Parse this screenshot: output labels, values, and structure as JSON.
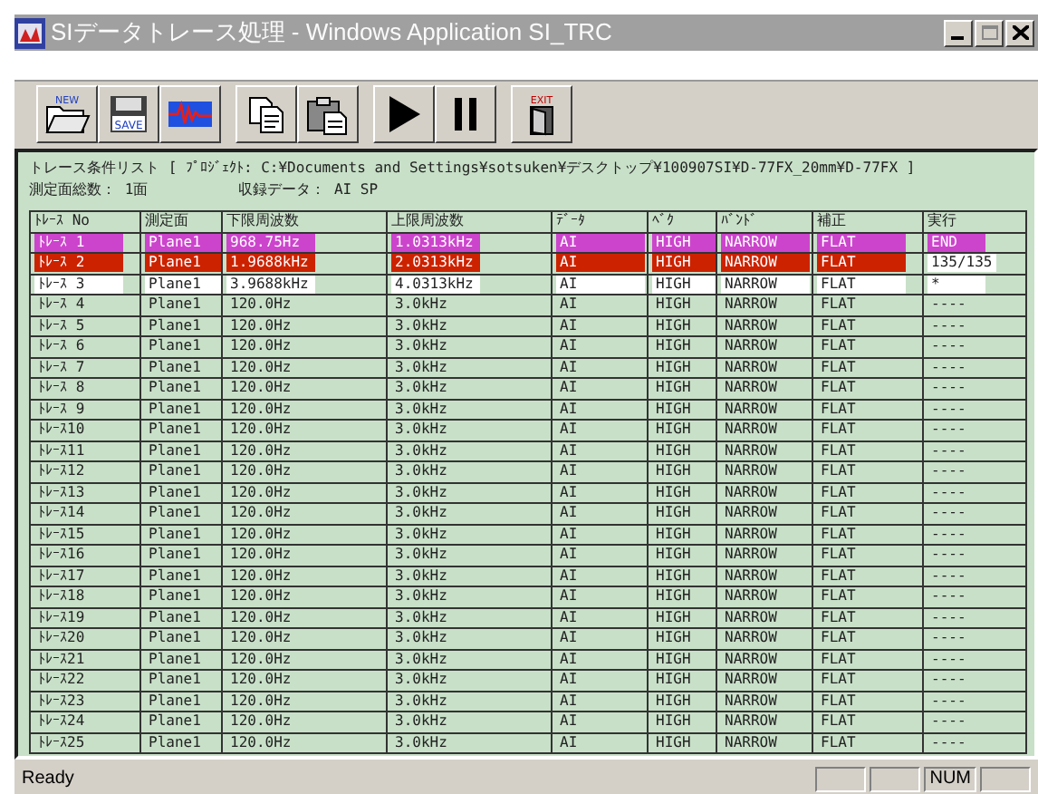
{
  "window": {
    "title": "SIデータトレース処理 - Windows  Application  SI_TRC"
  },
  "toolbar": [
    [
      {
        "kind": "new",
        "badge": "NEW"
      },
      {
        "kind": "save",
        "badge": "SAVE"
      },
      {
        "kind": "wave"
      }
    ],
    [
      {
        "kind": "copy"
      },
      {
        "kind": "paste"
      }
    ],
    [
      {
        "kind": "play"
      },
      {
        "kind": "pause"
      }
    ],
    [
      {
        "kind": "exit",
        "badge": "EXIT"
      }
    ]
  ],
  "info": {
    "list_title": "トレース条件リスト [ ﾌﾟﾛｼﾞｪｸﾄ: C:¥Documents and Settings¥sotsuken¥デスクトップ¥100907SI¥D-77FX_20mm¥D-77FX ]",
    "plane_count": "測定面総数： 1面",
    "recorded_data": "収録データ： AI  SP"
  },
  "table": {
    "columns": [
      "ﾄﾚｰｽ No",
      "測定面",
      "下限周波数",
      "上限周波数",
      "ﾃﾞｰﾀ",
      "ﾍﾞｸ",
      "ﾊﾞﾝﾄﾞ",
      "補正",
      "実行"
    ],
    "rows": [
      {
        "cells": [
          "ﾄﾚｰｽ 1",
          "Plane1",
          "968.75Hz",
          "1.0313kHz",
          "AI",
          "HIGH",
          "NARROW",
          "FLAT"
        ],
        "color": "#cc44cc",
        "exec": {
          "text": "END",
          "color": "#cc44cc"
        }
      },
      {
        "cells": [
          "ﾄﾚｰｽ 2",
          "Plane1",
          "1.9688kHz",
          "2.0313kHz",
          "AI",
          "HIGH",
          "NARROW",
          "FLAT"
        ],
        "color": "#cc2200",
        "exec": {
          "text": "135/135",
          "color": "#ffffff"
        }
      },
      {
        "cells": [
          "ﾄﾚｰｽ 3",
          "Plane1",
          "3.9688kHz",
          "4.0313kHz",
          "AI",
          "HIGH",
          "NARROW",
          "FLAT"
        ],
        "color": "#ffffff",
        "exec": {
          "text": "*",
          "color": "#ffffff"
        }
      },
      {
        "cells": [
          "ﾄﾚｰｽ 4",
          "Plane1",
          "120.0Hz",
          "3.0kHz",
          "AI",
          "HIGH",
          "NARROW",
          "FLAT",
          "----"
        ]
      },
      {
        "cells": [
          "ﾄﾚｰｽ 5",
          "Plane1",
          "120.0Hz",
          "3.0kHz",
          "AI",
          "HIGH",
          "NARROW",
          "FLAT",
          "----"
        ]
      },
      {
        "cells": [
          "ﾄﾚｰｽ 6",
          "Plane1",
          "120.0Hz",
          "3.0kHz",
          "AI",
          "HIGH",
          "NARROW",
          "FLAT",
          "----"
        ]
      },
      {
        "cells": [
          "ﾄﾚｰｽ 7",
          "Plane1",
          "120.0Hz",
          "3.0kHz",
          "AI",
          "HIGH",
          "NARROW",
          "FLAT",
          "----"
        ]
      },
      {
        "cells": [
          "ﾄﾚｰｽ 8",
          "Plane1",
          "120.0Hz",
          "3.0kHz",
          "AI",
          "HIGH",
          "NARROW",
          "FLAT",
          "----"
        ]
      },
      {
        "cells": [
          "ﾄﾚｰｽ 9",
          "Plane1",
          "120.0Hz",
          "3.0kHz",
          "AI",
          "HIGH",
          "NARROW",
          "FLAT",
          "----"
        ]
      },
      {
        "cells": [
          "ﾄﾚｰｽ10",
          "Plane1",
          "120.0Hz",
          "3.0kHz",
          "AI",
          "HIGH",
          "NARROW",
          "FLAT",
          "----"
        ]
      },
      {
        "cells": [
          "ﾄﾚｰｽ11",
          "Plane1",
          "120.0Hz",
          "3.0kHz",
          "AI",
          "HIGH",
          "NARROW",
          "FLAT",
          "----"
        ]
      },
      {
        "cells": [
          "ﾄﾚｰｽ12",
          "Plane1",
          "120.0Hz",
          "3.0kHz",
          "AI",
          "HIGH",
          "NARROW",
          "FLAT",
          "----"
        ]
      },
      {
        "cells": [
          "ﾄﾚｰｽ13",
          "Plane1",
          "120.0Hz",
          "3.0kHz",
          "AI",
          "HIGH",
          "NARROW",
          "FLAT",
          "----"
        ]
      },
      {
        "cells": [
          "ﾄﾚｰｽ14",
          "Plane1",
          "120.0Hz",
          "3.0kHz",
          "AI",
          "HIGH",
          "NARROW",
          "FLAT",
          "----"
        ]
      },
      {
        "cells": [
          "ﾄﾚｰｽ15",
          "Plane1",
          "120.0Hz",
          "3.0kHz",
          "AI",
          "HIGH",
          "NARROW",
          "FLAT",
          "----"
        ]
      },
      {
        "cells": [
          "ﾄﾚｰｽ16",
          "Plane1",
          "120.0Hz",
          "3.0kHz",
          "AI",
          "HIGH",
          "NARROW",
          "FLAT",
          "----"
        ]
      },
      {
        "cells": [
          "ﾄﾚｰｽ17",
          "Plane1",
          "120.0Hz",
          "3.0kHz",
          "AI",
          "HIGH",
          "NARROW",
          "FLAT",
          "----"
        ]
      },
      {
        "cells": [
          "ﾄﾚｰｽ18",
          "Plane1",
          "120.0Hz",
          "3.0kHz",
          "AI",
          "HIGH",
          "NARROW",
          "FLAT",
          "----"
        ]
      },
      {
        "cells": [
          "ﾄﾚｰｽ19",
          "Plane1",
          "120.0Hz",
          "3.0kHz",
          "AI",
          "HIGH",
          "NARROW",
          "FLAT",
          "----"
        ]
      },
      {
        "cells": [
          "ﾄﾚｰｽ20",
          "Plane1",
          "120.0Hz",
          "3.0kHz",
          "AI",
          "HIGH",
          "NARROW",
          "FLAT",
          "----"
        ]
      },
      {
        "cells": [
          "ﾄﾚｰｽ21",
          "Plane1",
          "120.0Hz",
          "3.0kHz",
          "AI",
          "HIGH",
          "NARROW",
          "FLAT",
          "----"
        ]
      },
      {
        "cells": [
          "ﾄﾚｰｽ22",
          "Plane1",
          "120.0Hz",
          "3.0kHz",
          "AI",
          "HIGH",
          "NARROW",
          "FLAT",
          "----"
        ]
      },
      {
        "cells": [
          "ﾄﾚｰｽ23",
          "Plane1",
          "120.0Hz",
          "3.0kHz",
          "AI",
          "HIGH",
          "NARROW",
          "FLAT",
          "----"
        ]
      },
      {
        "cells": [
          "ﾄﾚｰｽ24",
          "Plane1",
          "120.0Hz",
          "3.0kHz",
          "AI",
          "HIGH",
          "NARROW",
          "FLAT",
          "----"
        ]
      },
      {
        "cells": [
          "ﾄﾚｰｽ25",
          "Plane1",
          "120.0Hz",
          "3.0kHz",
          "AI",
          "HIGH",
          "NARROW",
          "FLAT",
          "----"
        ]
      }
    ]
  },
  "status_bar": {
    "message": "Ready",
    "indicators": [
      {
        "kind": "pane"
      },
      {
        "kind": "pane"
      },
      {
        "kind": "pane",
        "text": "NUM"
      },
      {
        "kind": "pane"
      }
    ]
  }
}
